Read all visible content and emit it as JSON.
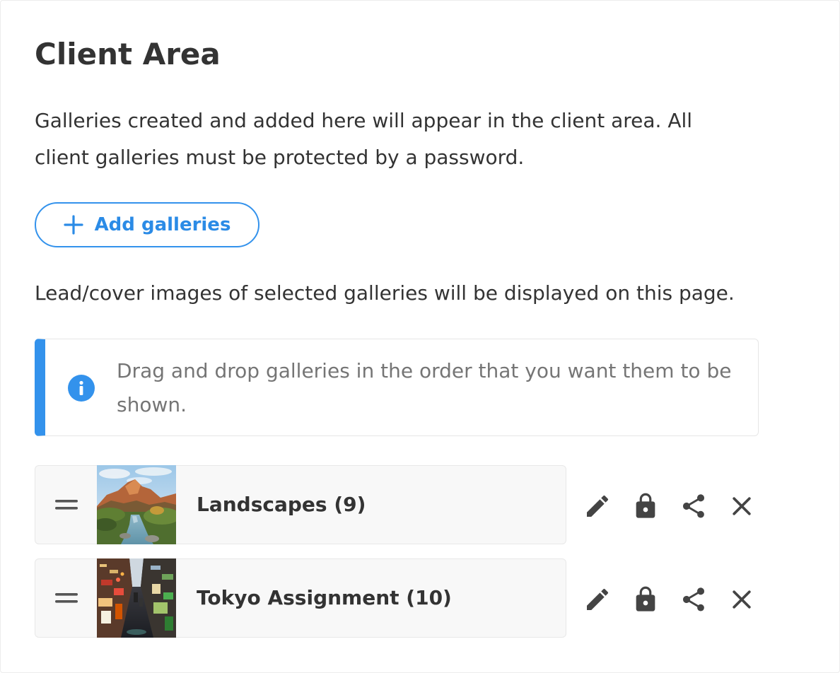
{
  "page": {
    "title": "Client Area",
    "intro": "Galleries created and added here will appear in the client area. All client galleries must be protected by a password.",
    "add_button": {
      "label": "Add galleries",
      "icon": "plus-icon"
    },
    "note": "Lead/cover images of selected galleries will be displayed on this page."
  },
  "info_box": {
    "icon": "info-icon",
    "text": "Drag and drop galleries in the order that you want them to be shown."
  },
  "galleries": [
    {
      "name": "Landscapes (9)",
      "thumbnail": "landscape-canyon-river-thumbnail",
      "actions": [
        "pencil-icon",
        "lock-icon",
        "share-icon",
        "close-icon"
      ]
    },
    {
      "name": "Tokyo Assignment (10)",
      "thumbnail": "tokyo-night-alley-thumbnail",
      "actions": [
        "pencil-icon",
        "lock-icon",
        "share-icon",
        "close-icon"
      ]
    }
  ],
  "colors": {
    "accent": "#3392ec",
    "text": "#333333",
    "muted_text": "#757575",
    "row_background": "#f8f8f8",
    "icon": "#444444"
  }
}
